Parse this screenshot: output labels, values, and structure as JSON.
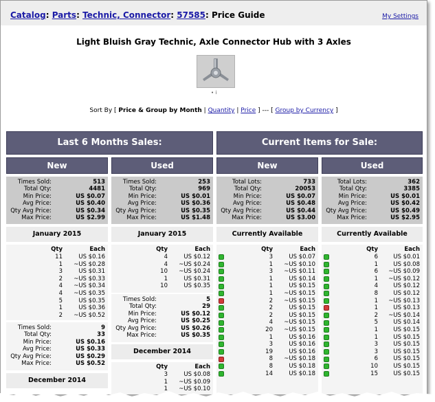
{
  "breadcrumb": {
    "catalog": "Catalog",
    "sep1": ":",
    "parts": "Parts",
    "sep2": ":",
    "category": "Technic, Connector",
    "sep3": ":",
    "item": "57585",
    "page": ": Price Guide"
  },
  "settings_link": "My Settings",
  "title": "Light Bluish Gray Technic, Axle Connector Hub with 3 Axles",
  "image_dots": "• i",
  "sort": {
    "prefix": "Sort By [",
    "current": "Price & Group by Month",
    "sep": "|",
    "quantity": "Quantity",
    "price": "Price",
    "mid": "] --- [",
    "currency": "Group by Currency",
    "suffix": "]"
  },
  "headers": {
    "past": "Last 6 Months Sales:",
    "current": "Current Items for Sale:",
    "new": "New",
    "used": "Used"
  },
  "stats": {
    "sold_new": [
      {
        "label": "Times Sold:",
        "value": "513"
      },
      {
        "label": "Total Qty:",
        "value": "4481"
      },
      {
        "label": "Min Price:",
        "value": "US $0.07"
      },
      {
        "label": "Avg Price:",
        "value": "US $0.40"
      },
      {
        "label": "Qty Avg Price:",
        "value": "US $0.34"
      },
      {
        "label": "Max Price:",
        "value": "US $2.99"
      }
    ],
    "sold_used": [
      {
        "label": "Times Sold:",
        "value": "253"
      },
      {
        "label": "Total Qty:",
        "value": "969"
      },
      {
        "label": "Min Price:",
        "value": "US $0.01"
      },
      {
        "label": "Avg Price:",
        "value": "US $0.36"
      },
      {
        "label": "Qty Avg Price:",
        "value": "US $0.35"
      },
      {
        "label": "Max Price:",
        "value": "US $1.48"
      }
    ],
    "sale_new": [
      {
        "label": "Total Lots:",
        "value": "733"
      },
      {
        "label": "Total Qty:",
        "value": "20053"
      },
      {
        "label": "Min Price:",
        "value": "US $0.07"
      },
      {
        "label": "Avg Price:",
        "value": "US $0.48"
      },
      {
        "label": "Qty Avg Price:",
        "value": "US $0.44"
      },
      {
        "label": "Max Price:",
        "value": "US $3.00"
      }
    ],
    "sale_used": [
      {
        "label": "Total Lots:",
        "value": "362"
      },
      {
        "label": "Total Qty:",
        "value": "3385"
      },
      {
        "label": "Min Price:",
        "value": "US $0.01"
      },
      {
        "label": "Avg Price:",
        "value": "US $0.42"
      },
      {
        "label": "Qty Avg Price:",
        "value": "US $0.49"
      },
      {
        "label": "Max Price:",
        "value": "US $2.95"
      }
    ]
  },
  "col_heads": {
    "qty": "Qty",
    "each": "Each"
  },
  "sold_new_month": {
    "month": "January 2015",
    "rows": [
      {
        "qty": "11",
        "each": "US $0.16"
      },
      {
        "qty": "1",
        "each": "~US $0.28"
      },
      {
        "qty": "3",
        "each": "US $0.31"
      },
      {
        "qty": "2",
        "each": "~US $0.33"
      },
      {
        "qty": "4",
        "each": "~US $0.34"
      },
      {
        "qty": "4",
        "each": "~US $0.35"
      },
      {
        "qty": "5",
        "each": "US $0.35"
      },
      {
        "qty": "1",
        "each": "US $0.36"
      },
      {
        "qty": "2",
        "each": "~US $0.52"
      }
    ],
    "summary": [
      {
        "label": "Times Sold:",
        "value": "9"
      },
      {
        "label": "Total Qty:",
        "value": "33"
      },
      {
        "label": "Min Price:",
        "value": "US $0.16"
      },
      {
        "label": "Avg Price:",
        "value": "US $0.33"
      },
      {
        "label": "Qty Avg Price:",
        "value": "US $0.29"
      },
      {
        "label": "Max Price:",
        "value": "US $0.52"
      }
    ],
    "next_month": "December 2014"
  },
  "sold_used_month": {
    "month": "January 2015",
    "rows": [
      {
        "qty": "4",
        "each": "US $0.12"
      },
      {
        "qty": "4",
        "each": "~US $0.24"
      },
      {
        "qty": "10",
        "each": "~US $0.24"
      },
      {
        "qty": "1",
        "each": "US $0.31"
      },
      {
        "qty": "10",
        "each": "US $0.35"
      }
    ],
    "summary": [
      {
        "label": "Times Sold:",
        "value": "5"
      },
      {
        "label": "Total Qty:",
        "value": "29"
      },
      {
        "label": "Min Price:",
        "value": "US $0.12"
      },
      {
        "label": "Avg Price:",
        "value": "US $0.25"
      },
      {
        "label": "Qty Avg Price:",
        "value": "US $0.26"
      },
      {
        "label": "Max Price:",
        "value": "US $0.35"
      }
    ],
    "next_month": "December 2014",
    "next_rows": [
      {
        "qty": "3",
        "each": "US $0.08"
      },
      {
        "qty": "1",
        "each": "~US $0.09"
      },
      {
        "qty": "1",
        "each": "~US $0.10"
      }
    ]
  },
  "available_label": "Currently Available",
  "sale_new_rows": [
    {
      "flag": "green",
      "qty": "3",
      "each": "US $0.07"
    },
    {
      "flag": "green",
      "qty": "1",
      "each": "~US $0.10"
    },
    {
      "flag": "green",
      "qty": "3",
      "each": "~US $0.11"
    },
    {
      "flag": "green",
      "qty": "1",
      "each": "US $0.14"
    },
    {
      "flag": "green",
      "qty": "1",
      "each": "US $0.15"
    },
    {
      "flag": "green",
      "qty": "1",
      "each": "~US $0.15"
    },
    {
      "flag": "red",
      "qty": "2",
      "each": "~US $0.15"
    },
    {
      "flag": "green",
      "qty": "2",
      "each": "US $0.15"
    },
    {
      "flag": "green",
      "qty": "2",
      "each": "US $0.15"
    },
    {
      "flag": "green",
      "qty": "4",
      "each": "~US $0.15"
    },
    {
      "flag": "green",
      "qty": "20",
      "each": "~US $0.15"
    },
    {
      "flag": "green",
      "qty": "1",
      "each": "US $0.16"
    },
    {
      "flag": "green",
      "qty": "3",
      "each": "US $0.16"
    },
    {
      "flag": "green",
      "qty": "19",
      "each": "US $0.16"
    },
    {
      "flag": "red",
      "qty": "8",
      "each": "~US $0.18"
    },
    {
      "flag": "green",
      "qty": "8",
      "each": "US $0.18"
    },
    {
      "flag": "green",
      "qty": "14",
      "each": "US $0.18"
    }
  ],
  "sale_used_rows": [
    {
      "flag": "green",
      "qty": "6",
      "each": "US $0.01"
    },
    {
      "flag": "green",
      "qty": "1",
      "each": "US $0.08"
    },
    {
      "flag": "green",
      "qty": "6",
      "each": "~US $0.09"
    },
    {
      "flag": "green",
      "qty": "1",
      "each": "~US $0.12"
    },
    {
      "flag": "green",
      "qty": "4",
      "each": "US $0.12"
    },
    {
      "flag": "green",
      "qty": "8",
      "each": "US $0.12"
    },
    {
      "flag": "green",
      "qty": "1",
      "each": "~US $0.13"
    },
    {
      "flag": "red",
      "qty": "1",
      "each": "US $0.13"
    },
    {
      "flag": "green",
      "qty": "2",
      "each": "~US $0.14"
    },
    {
      "flag": "green",
      "qty": "5",
      "each": "US $0.14"
    },
    {
      "flag": "green",
      "qty": "1",
      "each": "US $0.15"
    },
    {
      "flag": "green",
      "qty": "1",
      "each": "US $0.15"
    },
    {
      "flag": "green",
      "qty": "3",
      "each": "US $0.15"
    },
    {
      "flag": "green",
      "qty": "3",
      "each": "US $0.15"
    },
    {
      "flag": "green",
      "qty": "6",
      "each": "US $0.15"
    },
    {
      "flag": "green",
      "qty": "10",
      "each": "US $0.15"
    },
    {
      "flag": "green",
      "qty": "15",
      "each": "US $0.15"
    }
  ],
  "colors": {
    "header_bg": "#5d5d78",
    "stats_bg": "#cacaca",
    "link": "#1a1aa6",
    "flag_green": "#2fb52f",
    "flag_red": "#d23a3a"
  }
}
